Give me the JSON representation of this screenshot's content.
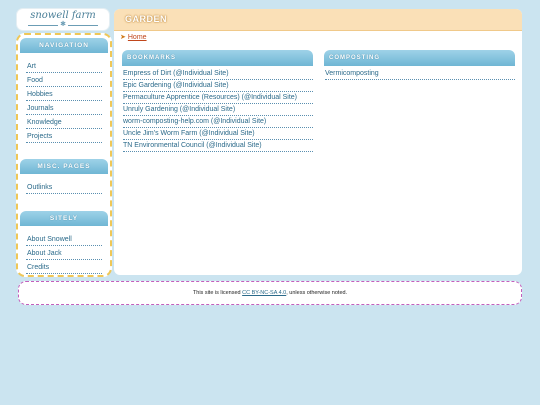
{
  "logo": {
    "name": "snowell farm",
    "ornament": "✱"
  },
  "sidebar": {
    "navigation": {
      "title": "NAVIGATION",
      "items": [
        "Art",
        "Food",
        "Hobbies",
        "Journals",
        "Knowledge",
        "Projects"
      ]
    },
    "misc": {
      "title": "MISC. PAGES",
      "items": [
        "Outlinks"
      ]
    },
    "sitely": {
      "title": "SITELY",
      "items": [
        "About Snowell",
        "About Jack",
        "Credits"
      ]
    }
  },
  "main": {
    "title": "GARDEN",
    "breadcrumb": {
      "arrow": "➤",
      "home": "Home"
    },
    "bookmarks": {
      "title": "BOOKMARKS",
      "items": [
        "Empress of Dirt (@Individual Site)",
        "Epic Gardening (@Individual Site)",
        "Permaculture Apprentice (Resources) (@Individual Site)",
        "Unruly Gardening (@Individual Site)",
        "worm-composting-help.com (@Individual Site)",
        "Uncle Jim's Worm Farm (@Individual Site)",
        "TN Environmental Council (@Individual Site)"
      ]
    },
    "composting": {
      "title": "COMPOSTING",
      "items": [
        "Vermicomposting"
      ]
    }
  },
  "footer": {
    "prefix": "This site is licensed",
    "license": "CC BY-NC-SA 4.0",
    "suffix": ", unless otherwise noted."
  },
  "colors": {
    "background": "#cbe4f0",
    "header_bar": "#fae0b7",
    "section_head": "#7fc0dc",
    "sidebar_border": "#efc757",
    "footer_border": "#c35fbc",
    "link": "#2b6a8a",
    "breadcrumb_link": "#c0461b"
  }
}
